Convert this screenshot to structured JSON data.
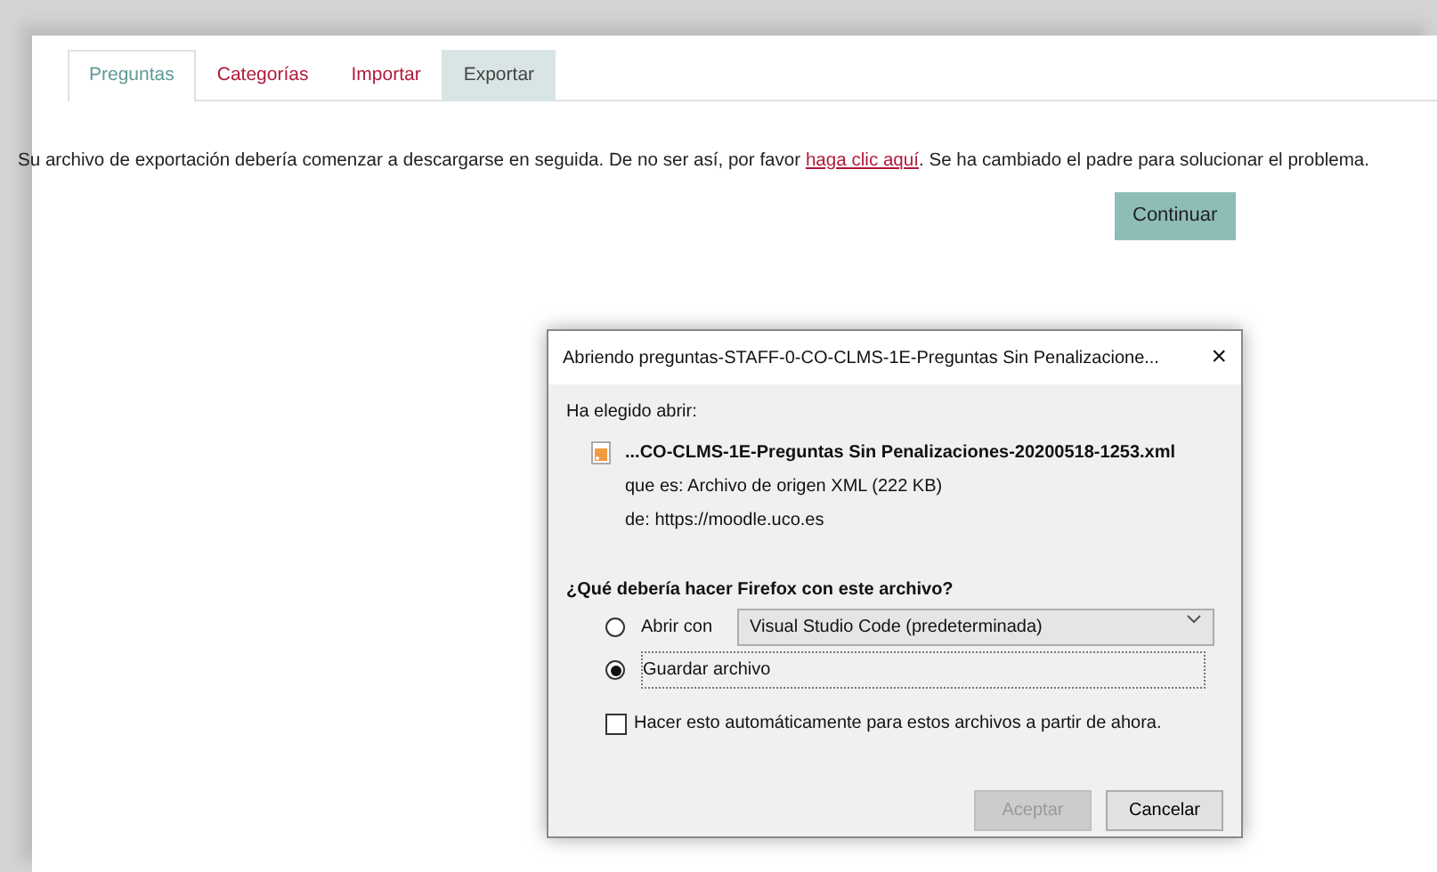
{
  "tabs": [
    {
      "label": "Preguntas",
      "selected": false,
      "kind": "first"
    },
    {
      "label": "Categorías",
      "selected": false,
      "kind": "link"
    },
    {
      "label": "Importar",
      "selected": false,
      "kind": "link"
    },
    {
      "label": "Exportar",
      "selected": true,
      "kind": "link"
    }
  ],
  "message": {
    "before": "Su archivo de exportación debería comenzar a descargarse en seguida. De no ser así, por favor ",
    "link": "haga clic aquí",
    "after": ". Se ha cambiado el padre para solucionar el problema."
  },
  "continue_button": "Continuar",
  "dialog": {
    "title": "Abriendo preguntas-STAFF-0-CO-CLMS-1E-Preguntas Sin Penalizacione...",
    "close": "×",
    "intro": "Ha elegido abrir:",
    "file_name": "...CO-CLMS-1E-Preguntas Sin Penalizaciones-20200518-1253.xml",
    "type_label": "que es:",
    "type_value": "Archivo de origen XML (222 KB)",
    "from_label": "de:",
    "from_value": "https://moodle.uco.es",
    "question": "¿Qué debería hacer Firefox con este archivo?",
    "options": [
      {
        "label": "Abrir con",
        "selected": false,
        "kind": "open"
      },
      {
        "label": "Guardar archivo",
        "selected": true,
        "kind": "save"
      }
    ],
    "open_with": "Visual Studio Code (predeterminada)",
    "auto": {
      "label": "Hacer esto automáticamente para estos archivos a partir de ahora.",
      "checked": false
    },
    "buttons": [
      {
        "label": "Aceptar",
        "disabled": true
      },
      {
        "label": "Cancelar",
        "disabled": false
      }
    ]
  }
}
